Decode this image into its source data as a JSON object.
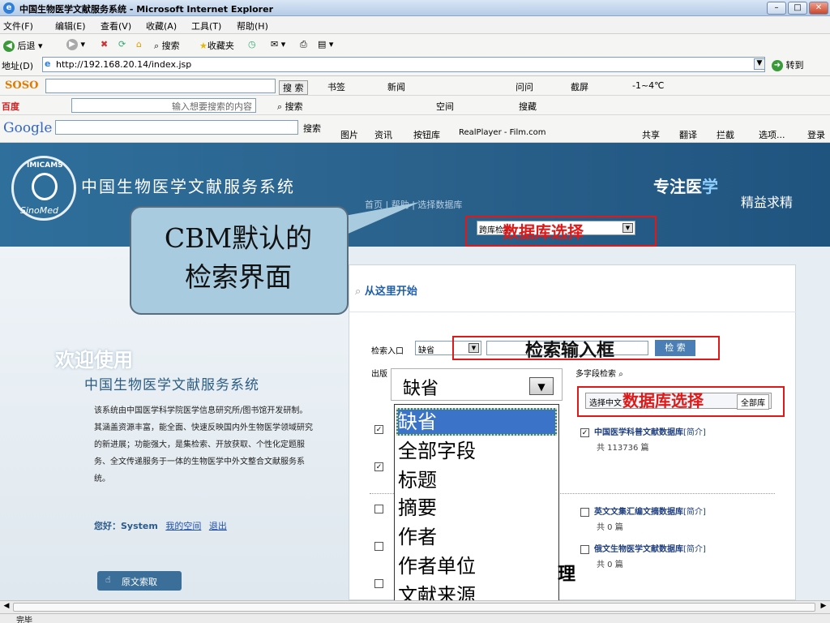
{
  "window": {
    "title": "中国生物医学文献服务系统 - Microsoft Internet Explorer"
  },
  "menu": [
    "文件(F)",
    "编辑(E)",
    "查看(V)",
    "收藏(A)",
    "工具(T)",
    "帮助(H)"
  ],
  "toolbar": {
    "back": "后退",
    "search": "搜索",
    "favorites": "收藏夹"
  },
  "address": {
    "label": "地址(D)",
    "url": "http://192.168.20.14/index.jsp",
    "go": "转到"
  },
  "soso": {
    "brand": "SOSO",
    "search_btn": "搜 索",
    "items": [
      "书签",
      "新闻",
      "问问",
      "截屏",
      "-1~4℃"
    ]
  },
  "baidu": {
    "brand": "百度",
    "placeholder": "输入想要搜索的内容",
    "search": "搜索",
    "items": [
      "空间",
      "搜藏"
    ]
  },
  "google": {
    "brand": "Google",
    "search": "搜索",
    "items": [
      "图片",
      "资讯",
      "按钮库",
      "RealPlayer - Film.com",
      "共享",
      "翻译",
      "拦截",
      "选项...",
      "登录"
    ]
  },
  "banner": {
    "logo_top": "IMICAMS",
    "logo_bottom": "SinoMed",
    "site_title": "中国生物医学文献服务系统",
    "slogan_main": "专注医",
    "slogan_highlight": "学",
    "slogan_sub": "精益求精",
    "crumb": "首页 | 帮助 | 选择数据库",
    "db_select": "跨库检索"
  },
  "left": {
    "welcome": "欢迎使用",
    "system_name": "中国生物医学文献服务系统",
    "intro": "该系统由中国医学科学院医学信息研究所/图书馆开发研制。其涵盖资源丰富，能全面、快速反映国内外生物医学领域研究的新进展；功能强大，是集检索、开放获取、个性化定题服务、全文传递服务于一体的生物医学中外文整合文献服务系统。",
    "greeting_label": "您好：",
    "user": "System",
    "my_space": "我的空间",
    "logout": "退出",
    "fulltext_btn": "原文索取"
  },
  "search": {
    "start": "从这里开始",
    "entry_label": "检索入口",
    "entry_value": "缺省",
    "button": "检 索",
    "year_label": "出版",
    "multi_field": "多字段检索",
    "select_bar": "选择中文",
    "all_db": "全部库"
  },
  "databases": [
    {
      "name": "中国医学科普文献数据库",
      "intro": "[简介]",
      "count": "共 113736 篇",
      "checked": true
    },
    {
      "name": "英文文集汇编文摘数据库",
      "intro": "[简介]",
      "count": "共 0 篇",
      "checked": false
    },
    {
      "name": "俄文生物医学文献数据库",
      "intro": "[简介]",
      "count": "共 0 篇",
      "checked": false
    }
  ],
  "callout": {
    "line1": "CBM默认的",
    "line2": "检索界面"
  },
  "annotations": {
    "db_select_top": "数据库选择",
    "search_box": "检索输入框",
    "db_select_right": "数据库选择",
    "trailing": "理"
  },
  "dropdown": {
    "current": "缺省",
    "options": [
      "缺省",
      "全部字段",
      "标题",
      "摘要",
      "作者",
      "作者单位",
      "文献来源"
    ]
  },
  "status": {
    "text": "完毕"
  },
  "colors": {
    "banner": "#2a628c",
    "annotation": "#e01818",
    "callout": "#a9cbdf",
    "selected": "#3a73c8"
  }
}
